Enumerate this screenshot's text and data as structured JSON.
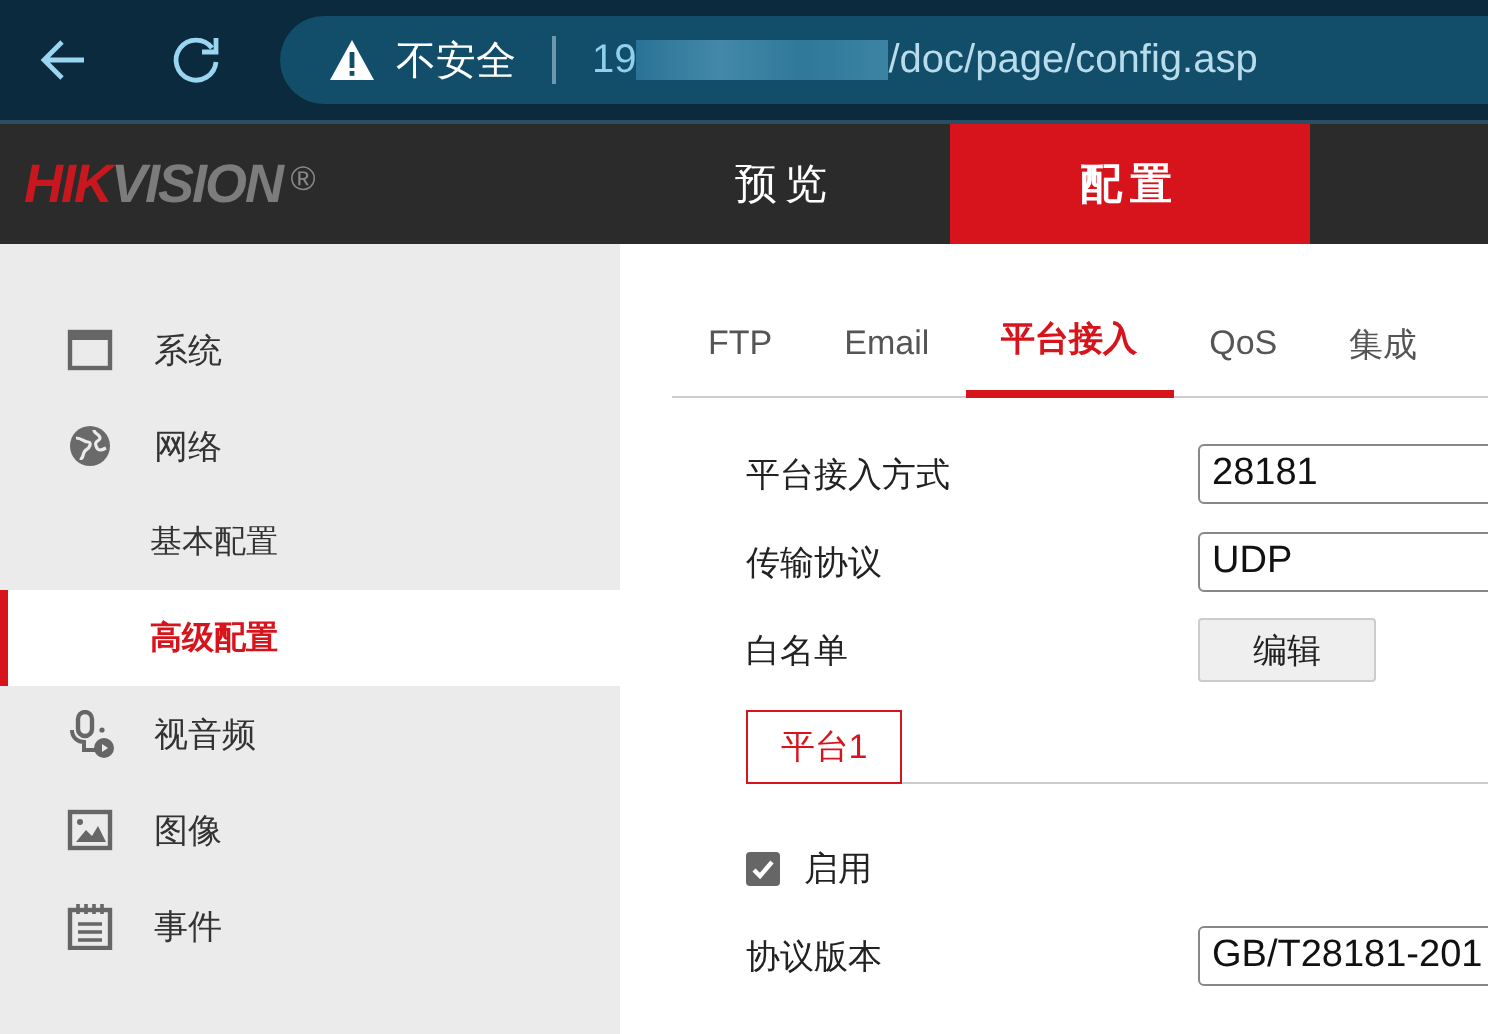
{
  "browser": {
    "security_label": "不安全",
    "url_prefix": "19",
    "url_path": "/doc/page/config.asp"
  },
  "header": {
    "logo": "HIKVISION",
    "logo_mark": "®",
    "nav": [
      {
        "label": "预览",
        "selected": false
      },
      {
        "label": "配置",
        "selected": true
      }
    ]
  },
  "sidebar": {
    "items": [
      {
        "label": "系统",
        "selected": false
      },
      {
        "label": "网络",
        "selected": false,
        "children": [
          {
            "label": "基本配置",
            "selected": false
          },
          {
            "label": "高级配置",
            "selected": true
          }
        ]
      },
      {
        "label": "视音频",
        "selected": false
      },
      {
        "label": "图像",
        "selected": false
      },
      {
        "label": "事件",
        "selected": false
      }
    ]
  },
  "tabs": [
    {
      "label": "FTP",
      "selected": false
    },
    {
      "label": "Email",
      "selected": false
    },
    {
      "label": "平台接入",
      "selected": true
    },
    {
      "label": "QoS",
      "selected": false
    },
    {
      "label": "集成",
      "selected": false
    }
  ],
  "form": {
    "rows": [
      {
        "kind": "field",
        "label": "平台接入方式",
        "value": "28181"
      },
      {
        "kind": "field",
        "label": "传输协议",
        "value": "UDP"
      },
      {
        "kind": "button",
        "label": "白名单",
        "button": "编辑"
      }
    ]
  },
  "platform_tabs": [
    {
      "label": "平台1",
      "selected": true
    }
  ],
  "platform": {
    "enable": {
      "label": "启用",
      "checked": true
    },
    "rows": [
      {
        "kind": "field",
        "label": "协议版本",
        "value": "GB/T28181-201"
      }
    ]
  }
}
